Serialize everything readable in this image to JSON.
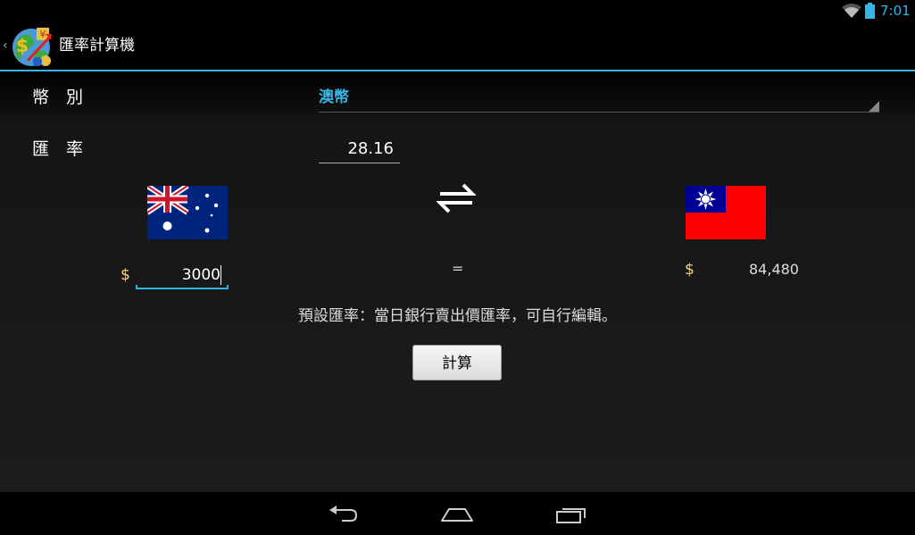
{
  "status_bar": {
    "time": "7:01",
    "icons": [
      "wifi-icon",
      "battery-icon"
    ]
  },
  "action_bar": {
    "title": "匯率計算機",
    "icon": "app-currency-icon",
    "up_icon": "chevron-left-icon"
  },
  "form": {
    "currency_label": "幣　別",
    "currency_value": "澳幣",
    "rate_label": "匯　率",
    "rate_value": "28.16"
  },
  "converter": {
    "from_flag": "australia-flag",
    "swap_icon": "swap-arrows-icon",
    "to_flag": "taiwan-flag",
    "from_symbol": "$",
    "from_amount": "3000",
    "equals": "=",
    "to_symbol": "$",
    "to_amount": "84,480"
  },
  "hint": "預設匯率：當日銀行賣出價匯率，可自行編輯。",
  "calculate_button": "計算",
  "colors": {
    "accent": "#33b5e5",
    "dollar": "#f5d78a",
    "background": "#000000"
  },
  "nav_bar": {
    "icons": [
      "back-icon",
      "home-icon",
      "recent-apps-icon"
    ]
  }
}
